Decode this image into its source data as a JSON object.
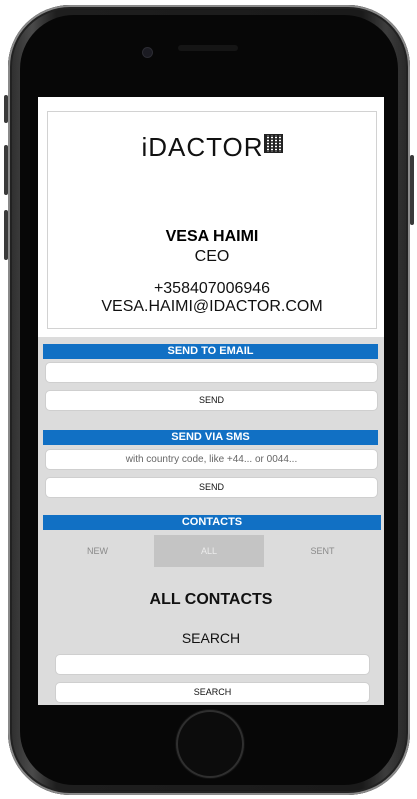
{
  "card": {
    "logo_text": "iDACTOR",
    "name": "VESA HAIMI",
    "title": "CEO",
    "phone": "+358407006946",
    "email": "VESA.HAIMI@IDACTOR.COM"
  },
  "send_email": {
    "header": "SEND TO EMAIL",
    "input_value": "",
    "button": "SEND"
  },
  "send_sms": {
    "header": "SEND VIA SMS",
    "placeholder": "with country code, like +44... or 0044...",
    "button": "SEND"
  },
  "contacts": {
    "header": "CONTACTS",
    "tabs": [
      {
        "label": "NEW",
        "active": false
      },
      {
        "label": "ALL",
        "active": true
      },
      {
        "label": "SENT",
        "active": false
      }
    ],
    "heading": "ALL CONTACTS",
    "search_label": "SEARCH",
    "search_value": "",
    "search_button": "SEARCH"
  },
  "colors": {
    "accent": "#1170c4",
    "screen_bg": "#dcdcdc",
    "active_tab": "#c4c4c4"
  },
  "icons": {
    "logo_mark": "qr-code-icon"
  }
}
